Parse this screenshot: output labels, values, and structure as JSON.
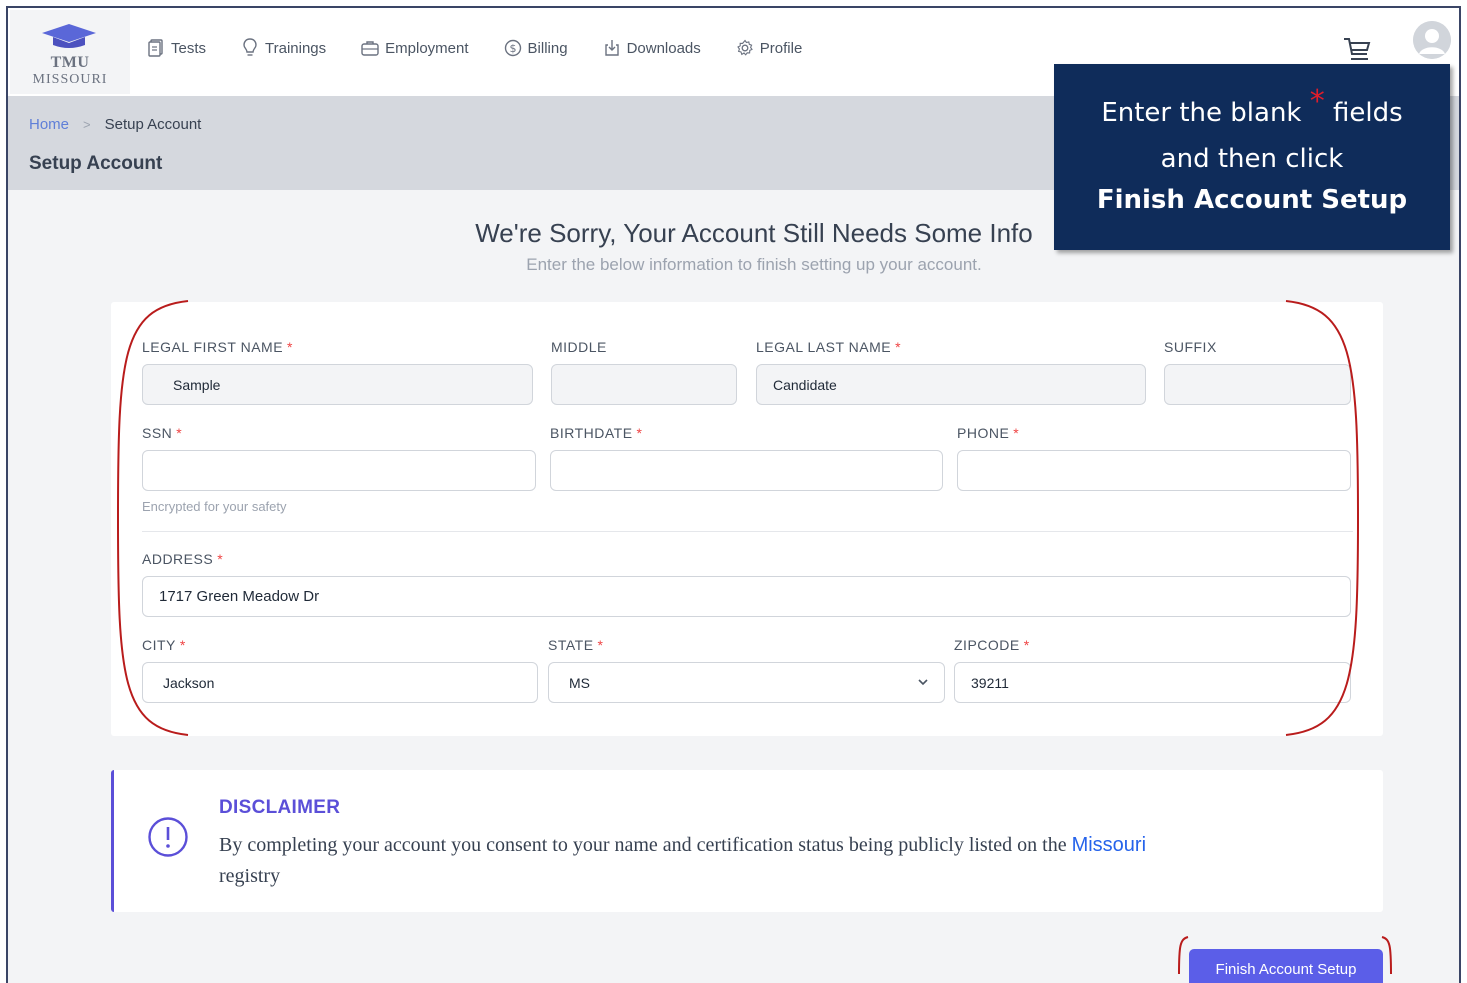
{
  "logo": {
    "line1": "TMU",
    "line2": "MISSOURI",
    "icon": "graduation-cap-icon"
  },
  "nav": [
    {
      "label": "Tests",
      "icon": "document-icon"
    },
    {
      "label": "Trainings",
      "icon": "lightbulb-icon"
    },
    {
      "label": "Employment",
      "icon": "briefcase-icon"
    },
    {
      "label": "Billing",
      "icon": "dollar-circle-icon"
    },
    {
      "label": "Downloads",
      "icon": "download-icon"
    },
    {
      "label": "Profile",
      "icon": "gear-icon"
    }
  ],
  "breadcrumb": {
    "home": "Home",
    "separator": ">",
    "current": "Setup Account"
  },
  "page_title": "Setup Account",
  "headline": "We're Sorry, Your Account Still Needs Some Info",
  "subline": "Enter the below information to finish setting up your account.",
  "callout": {
    "line1_a": "Enter the blank",
    "star": "*",
    "line1_b": "fields",
    "line2": "and then click",
    "line3": "Finish Account Setup"
  },
  "form": {
    "required_mark": "*",
    "first_name": {
      "label": "LEGAL FIRST NAME",
      "value": "Sample"
    },
    "middle": {
      "label": "MIDDLE",
      "value": ""
    },
    "last_name": {
      "label": "LEGAL LAST NAME",
      "value": "Candidate"
    },
    "suffix": {
      "label": "SUFFIX",
      "value": ""
    },
    "ssn": {
      "label": "SSN",
      "value": "",
      "hint": "Encrypted for your safety"
    },
    "birthdate": {
      "label": "BIRTHDATE",
      "value": ""
    },
    "phone": {
      "label": "PHONE",
      "value": ""
    },
    "address": {
      "label": "ADDRESS",
      "value": "1717 Green Meadow Dr"
    },
    "city": {
      "label": "CITY",
      "value": "Jackson"
    },
    "state": {
      "label": "STATE",
      "value": "MS"
    },
    "zipcode": {
      "label": "ZIPCODE",
      "value": "39211"
    }
  },
  "disclaimer": {
    "title": "DISCLAIMER",
    "text": "By completing your account you consent to your name and certification status being publicly listed on the",
    "link": "Missouri",
    "text_end": "registry"
  },
  "finish_button": "Finish Account Setup",
  "colors": {
    "accent": "#5b5ee8",
    "callout_bg": "#0f2c5a",
    "highlight": "#b91c1c"
  }
}
